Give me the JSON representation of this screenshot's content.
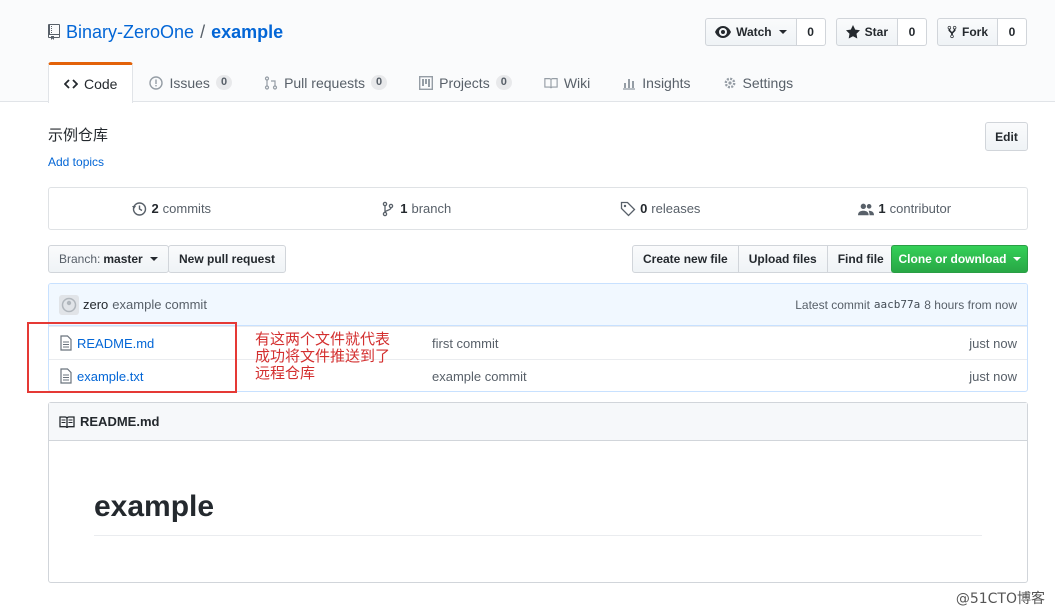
{
  "repo": {
    "owner": "Binary-ZeroOne",
    "separator": "/",
    "name": "example"
  },
  "actions": {
    "watch_label": "Watch",
    "watch_count": "0",
    "star_label": "Star",
    "star_count": "0",
    "fork_label": "Fork",
    "fork_count": "0"
  },
  "nav": {
    "code": "Code",
    "issues": "Issues",
    "issues_count": "0",
    "pulls": "Pull requests",
    "pulls_count": "0",
    "projects": "Projects",
    "projects_count": "0",
    "wiki": "Wiki",
    "insights": "Insights",
    "settings": "Settings"
  },
  "description": {
    "text": "示例仓库",
    "add_topics": "Add topics",
    "edit_label": "Edit"
  },
  "numbers": {
    "commits_count": "2",
    "commits_label": "commits",
    "branch_count": "1",
    "branch_label": "branch",
    "releases_count": "0",
    "releases_label": "releases",
    "contributor_count": "1",
    "contributor_label": "contributor"
  },
  "file_nav": {
    "branch_label": "Branch:",
    "branch_value": "master",
    "new_pr": "New pull request",
    "create_file": "Create new file",
    "upload_files": "Upload files",
    "find_file": "Find file",
    "clone": "Clone or download"
  },
  "commit": {
    "author": "zero",
    "message": "example commit",
    "latest_label": "Latest commit",
    "sha": "aacb77a",
    "age": "8 hours from now"
  },
  "files": [
    {
      "name": "README.md",
      "message": "first commit",
      "age": "just now"
    },
    {
      "name": "example.txt",
      "message": "example commit",
      "age": "just now"
    }
  ],
  "annotation": {
    "line1": "有这两个文件就代表",
    "line2": "成功将文件推送到了",
    "line3": "远程仓库"
  },
  "readme": {
    "filename": "README.md",
    "heading": "example"
  },
  "watermark": "@51CTO博客",
  "colors": {
    "accent": "#0366d6",
    "nav_selected": "#e36209",
    "clone_green": "#28a745",
    "annotation_red": "#e53935"
  }
}
